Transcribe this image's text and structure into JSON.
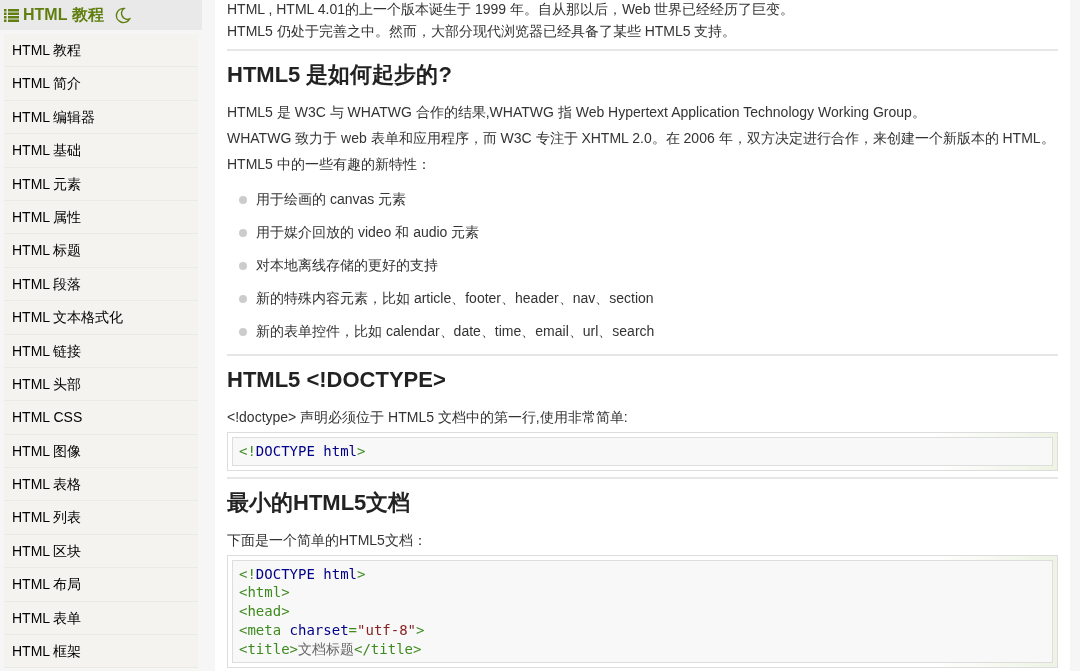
{
  "sidebar": {
    "title": "HTML 教程",
    "items": [
      {
        "label": "HTML 教程"
      },
      {
        "label": "HTML 简介"
      },
      {
        "label": "HTML 编辑器"
      },
      {
        "label": "HTML 基础"
      },
      {
        "label": "HTML 元素"
      },
      {
        "label": "HTML 属性"
      },
      {
        "label": "HTML 标题"
      },
      {
        "label": "HTML 段落"
      },
      {
        "label": "HTML 文本格式化"
      },
      {
        "label": "HTML 链接"
      },
      {
        "label": "HTML 头部"
      },
      {
        "label": "HTML CSS"
      },
      {
        "label": "HTML 图像"
      },
      {
        "label": "HTML 表格"
      },
      {
        "label": "HTML 列表"
      },
      {
        "label": "HTML 区块"
      },
      {
        "label": "HTML 布局"
      },
      {
        "label": "HTML 表单"
      },
      {
        "label": "HTML 框架"
      }
    ]
  },
  "content": [
    {
      "kind": "p",
      "text": "HTML , HTML 4.01的上一个版本诞生于 1999 年。自从那以后，Web 世界已经经历了巨变。"
    },
    {
      "kind": "p",
      "text": "HTML5 仍处于完善之中。然而，大部分现代浏览器已经具备了某些 HTML5 支持。"
    },
    {
      "kind": "hr"
    },
    {
      "kind": "h2",
      "text": "HTML5 是如何起步的?"
    },
    {
      "kind": "p",
      "text": "HTML5 是 W3C 与 WHATWG 合作的结果,WHATWG 指 Web Hypertext Application Technology Working Group。"
    },
    {
      "kind": "p",
      "text": "WHATWG 致力于 web 表单和应用程序，而 W3C 专注于 XHTML 2.0。在 2006 年，双方决定进行合作，来创建一个新版本的 HTML。"
    },
    {
      "kind": "p",
      "text": "HTML5 中的一些有趣的新特性："
    },
    {
      "kind": "ul",
      "items": [
        "用于绘画的 canvas 元素",
        "用于媒介回放的 video 和 audio 元素",
        "对本地离线存储的更好的支持",
        "新的特殊内容元素，比如 article、footer、header、nav、section",
        "新的表单控件，比如 calendar、date、time、email、url、search"
      ]
    },
    {
      "kind": "hr"
    },
    {
      "kind": "h2",
      "text": "HTML5 <!DOCTYPE>"
    },
    {
      "kind": "p",
      "text": "<!doctype> 声明必须位于 HTML5 文档中的第一行,使用非常简单:"
    },
    {
      "kind": "code",
      "lines": [
        [
          {
            "kind": "tag",
            "text": "<!"
          },
          {
            "kind": "kw",
            "text": "DOCTYPE html"
          },
          {
            "kind": "tag",
            "text": ">"
          }
        ]
      ]
    },
    {
      "kind": "hr"
    },
    {
      "kind": "h2",
      "text": "最小的HTML5文档"
    },
    {
      "kind": "p",
      "text": "下面是一个简单的HTML5文档："
    },
    {
      "kind": "code",
      "lines": [
        [
          {
            "kind": "tag",
            "text": "<!"
          },
          {
            "kind": "kw",
            "text": "DOCTYPE html"
          },
          {
            "kind": "tag",
            "text": ">"
          }
        ],
        [
          {
            "kind": "tag",
            "text": "<html>"
          }
        ],
        [
          {
            "kind": "tag",
            "text": "<head>"
          }
        ],
        [
          {
            "kind": "tag",
            "text": "<meta "
          },
          {
            "kind": "kw",
            "text": "charset"
          },
          {
            "kind": "tag",
            "text": "="
          },
          {
            "kind": "str",
            "text": "\"utf-8\""
          },
          {
            "kind": "tag",
            "text": ">"
          }
        ],
        [
          {
            "kind": "tag",
            "text": "<title>"
          },
          {
            "kind": "text",
            "text": "文档标题"
          },
          {
            "kind": "tag",
            "text": "</title>"
          }
        ]
      ]
    }
  ]
}
